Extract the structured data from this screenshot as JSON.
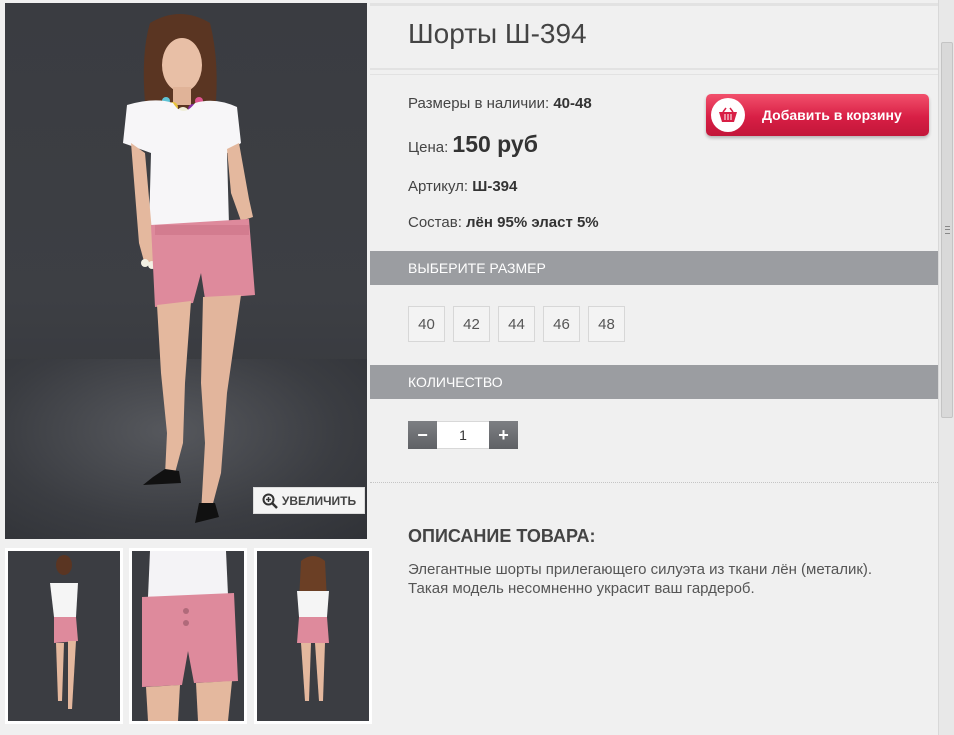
{
  "product": {
    "title": "Шорты Ш-394",
    "sizes_label": "Размеры в наличии:",
    "sizes_value": "40-48",
    "price_label": "Цена:",
    "price_value": "150 руб",
    "sku_label": "Артикул:",
    "sku_value": "Ш-394",
    "composition_label": "Состав:",
    "composition_value": "лён 95% эласт 5%"
  },
  "cart_button": {
    "label": "Добавить в корзину",
    "icon": "basket-icon",
    "color": "#d81f45"
  },
  "gallery": {
    "zoom_label": "УВЕЛИЧИТЬ",
    "zoom_icon": "magnifier-plus-icon"
  },
  "size_section": {
    "title": "ВЫБЕРИТЕ РАЗМЕР",
    "options": [
      "40",
      "42",
      "44",
      "46",
      "48"
    ]
  },
  "quantity_section": {
    "title": "КОЛИЧЕСТВО",
    "value": "1",
    "minus": "−",
    "plus": "+"
  },
  "description": {
    "title": "ОПИСАНИЕ ТОВАРА:",
    "text": "Элегантные шорты прилегающего силуэта из ткани лён (металик). Такая модель несомненно украсит ваш гардероб."
  },
  "colors": {
    "section_bar": "#9b9da1",
    "shorts_pink": "#de8a9c",
    "backdrop": "#3a3c41"
  }
}
